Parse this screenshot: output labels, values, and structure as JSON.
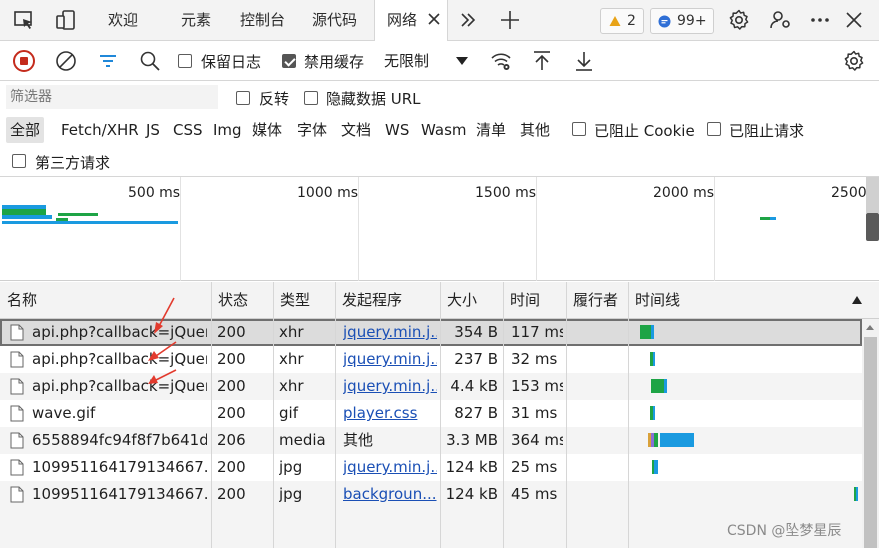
{
  "tabs": {
    "welcome": "欢迎",
    "elements": "元素",
    "console": "控制台",
    "sources": "源代码",
    "network": "网络"
  },
  "badges": {
    "warnings": "2",
    "messages": "99+"
  },
  "toolbar": {
    "preserve_log": "保留日志",
    "disable_cache": "禁用缓存",
    "throttle": "无限制"
  },
  "filter": {
    "placeholder": "筛选器",
    "invert": "反转",
    "hide_data_urls": "隐藏数据 URL",
    "types": [
      "全部",
      "Fetch/XHR",
      "JS",
      "CSS",
      "Img",
      "媒体",
      "字体",
      "文档",
      "WS",
      "Wasm",
      "清单",
      "其他"
    ],
    "blocked_cookies": "已阻止 Cookie",
    "blocked_requests": "已阻止请求",
    "third_party": "第三方请求"
  },
  "overview": {
    "ticks": [
      "500 ms",
      "1000 ms",
      "1500 ms",
      "2000 ms",
      "2500"
    ]
  },
  "table": {
    "headers": {
      "name": "名称",
      "status": "状态",
      "type": "类型",
      "initiator": "发起程序",
      "size": "大小",
      "time": "时间",
      "fulfilled_by": "履行者",
      "waterfall": "时间线"
    },
    "rows": [
      {
        "name": "api.php?callback=jQuer...",
        "status": "200",
        "type": "xhr",
        "initiator": "jquery.min.j...",
        "size": "354 B",
        "time": "117 ms"
      },
      {
        "name": "api.php?callback=jQuer...",
        "status": "200",
        "type": "xhr",
        "initiator": "jquery.min.j...",
        "size": "237 B",
        "time": "32 ms"
      },
      {
        "name": "api.php?callback=jQuer...",
        "status": "200",
        "type": "xhr",
        "initiator": "jquery.min.j...",
        "size": "4.4 kB",
        "time": "153 ms"
      },
      {
        "name": "wave.gif",
        "status": "200",
        "type": "gif",
        "initiator": "player.css",
        "size": "827 B",
        "time": "31 ms"
      },
      {
        "name": "6558894fc94f8f7b641d...",
        "status": "206",
        "type": "media",
        "initiator": "其他",
        "size": "3.3 MB",
        "time": "364 ms"
      },
      {
        "name": "109951164179134667.j...",
        "status": "200",
        "type": "jpg",
        "initiator": "jquery.min.j...",
        "size": "124 kB",
        "time": "25 ms"
      },
      {
        "name": "109951164179134667.j...",
        "status": "200",
        "type": "jpg",
        "initiator": "backgroun...",
        "size": "124 kB",
        "time": "45 ms"
      }
    ]
  },
  "watermark": "CSDN @坠梦星辰",
  "colors": {
    "accent": "#0078d4",
    "record_red": "#c42b1c",
    "waiting_green": "#1ea446",
    "download_blue": "#1a9ae0",
    "link": "#1a4fb5"
  }
}
